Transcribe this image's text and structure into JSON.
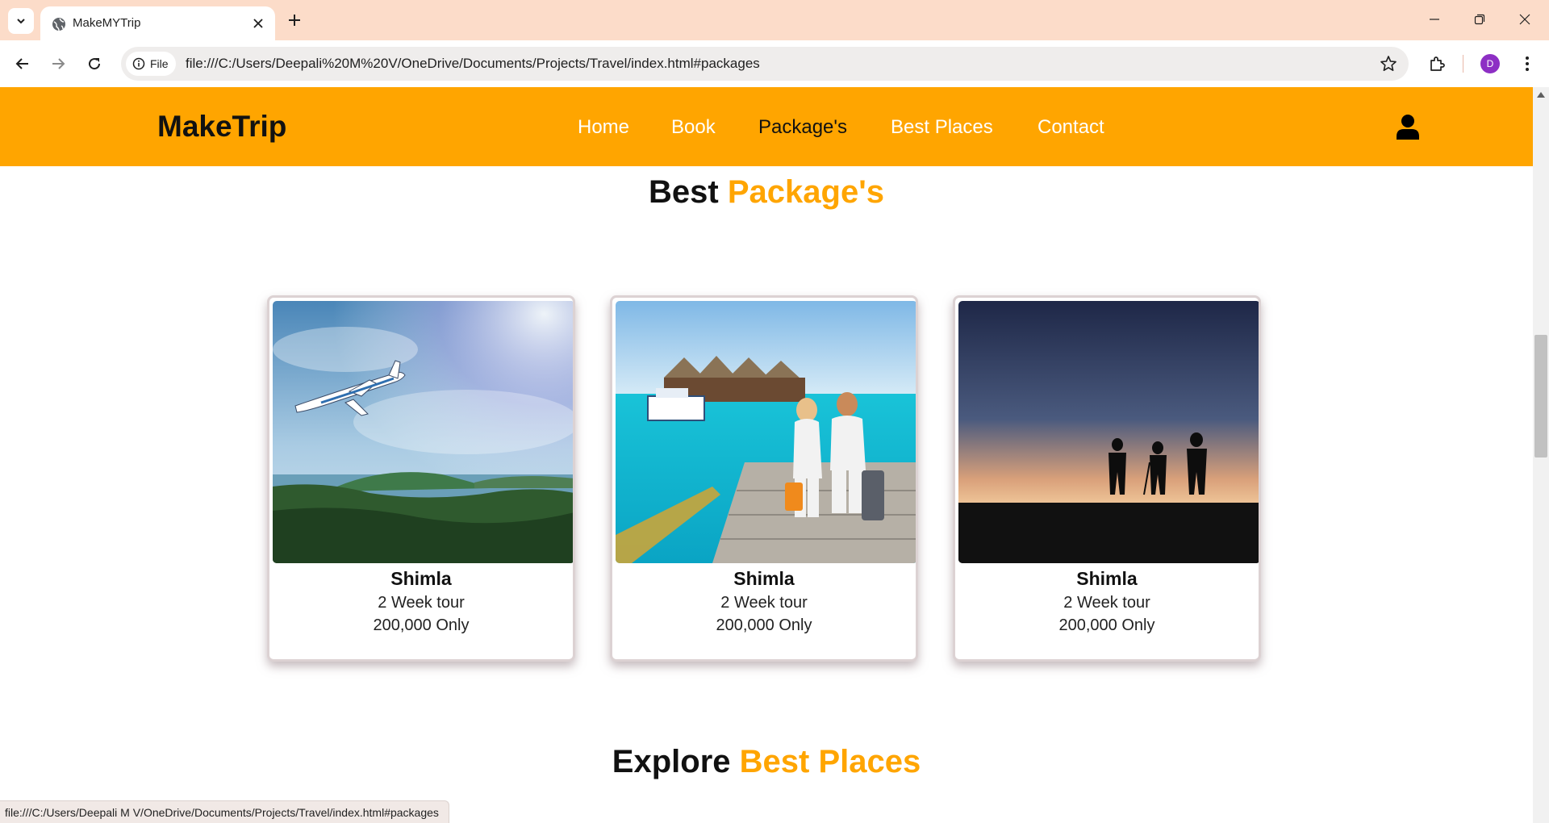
{
  "browser": {
    "tab_title": "MakeMYTrip",
    "chip_label": "File",
    "url": "file:///C:/Users/Deepali%20M%20V/OneDrive/Documents/Projects/Travel/index.html#packages",
    "avatar_letter": "D",
    "status_url": "file:///C:/Users/Deepali M V/OneDrive/Documents/Projects/Travel/index.html#packages",
    "icons": [
      "tab-search-icon",
      "globe-icon",
      "close-icon",
      "plus-icon",
      "minimize-icon",
      "restore-icon",
      "window-close-icon",
      "back-arrow-icon",
      "forward-arrow-icon",
      "reload-icon",
      "info-icon",
      "star-icon",
      "extensions-icon",
      "kebab-menu-icon"
    ]
  },
  "site": {
    "logo": "MakeTrip",
    "nav": [
      "Home",
      "Book",
      "Package's",
      "Best Places",
      "Contact"
    ],
    "active_nav": "Package's",
    "user_icon": "user-icon",
    "colors": {
      "accent": "#ffa500",
      "text": "#111111"
    }
  },
  "packages": {
    "title_prefix": "Best",
    "title_accent": "Package's",
    "cards": [
      {
        "name": "Shimla",
        "duration": "2 Week tour",
        "price": "200,000 Only",
        "image": "airplane over island photo"
      },
      {
        "name": "Shimla",
        "duration": "2 Week tour",
        "price": "200,000 Only",
        "image": "couple on jetty with luggage at overwater villas"
      },
      {
        "name": "Shimla",
        "duration": "2 Week tour",
        "price": "200,000 Only",
        "image": "hikers silhouetted at sunset"
      }
    ]
  },
  "places": {
    "title_prefix": "Explore",
    "title_accent": "Best Places"
  }
}
